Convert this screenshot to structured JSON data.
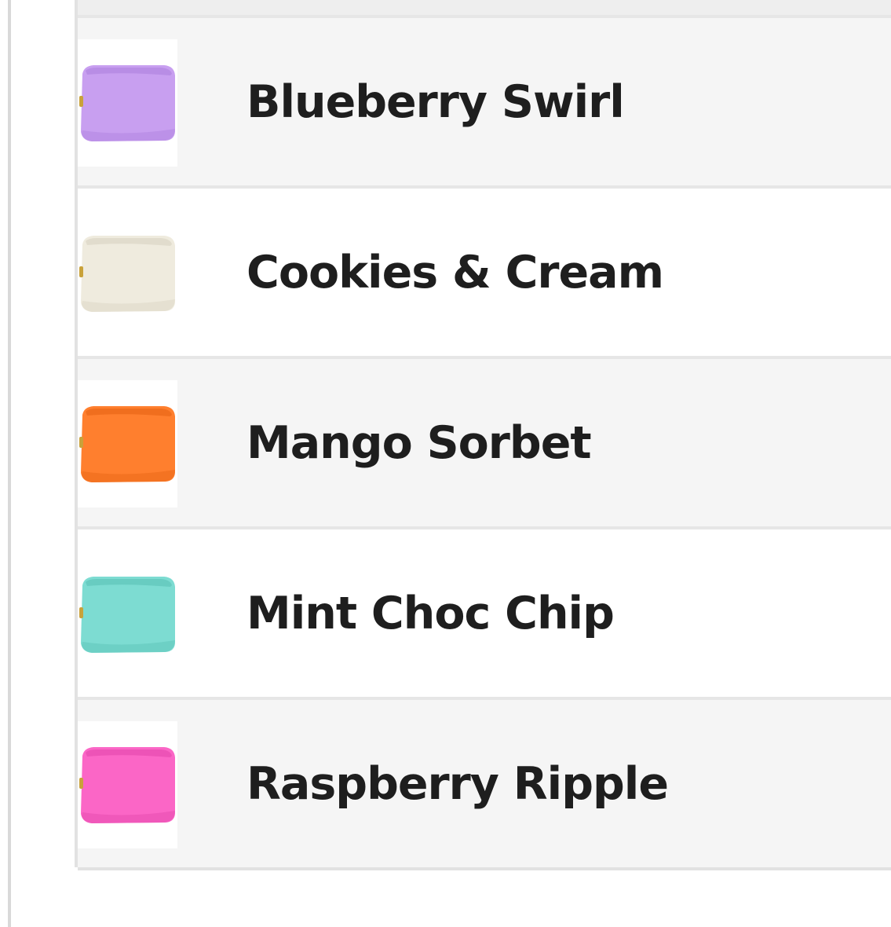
{
  "variants": [
    {
      "name": "Blueberry Swirl",
      "thumbnail": "pouch-icon",
      "color": "#c89ff0",
      "shade": "#b488e2"
    },
    {
      "name": "Cookies & Cream",
      "thumbnail": "pouch-icon",
      "color": "#efebde",
      "shade": "#ddd8c8"
    },
    {
      "name": "Mango Sorbet",
      "thumbnail": "pouch-icon",
      "color": "#ff7f2e",
      "shade": "#ec6a1a"
    },
    {
      "name": "Mint Choc Chip",
      "thumbnail": "pouch-icon",
      "color": "#7ddcd2",
      "shade": "#63c8bd"
    },
    {
      "name": "Raspberry Ripple",
      "thumbnail": "pouch-icon",
      "color": "#fb66c6",
      "shade": "#ea4fb3"
    }
  ]
}
